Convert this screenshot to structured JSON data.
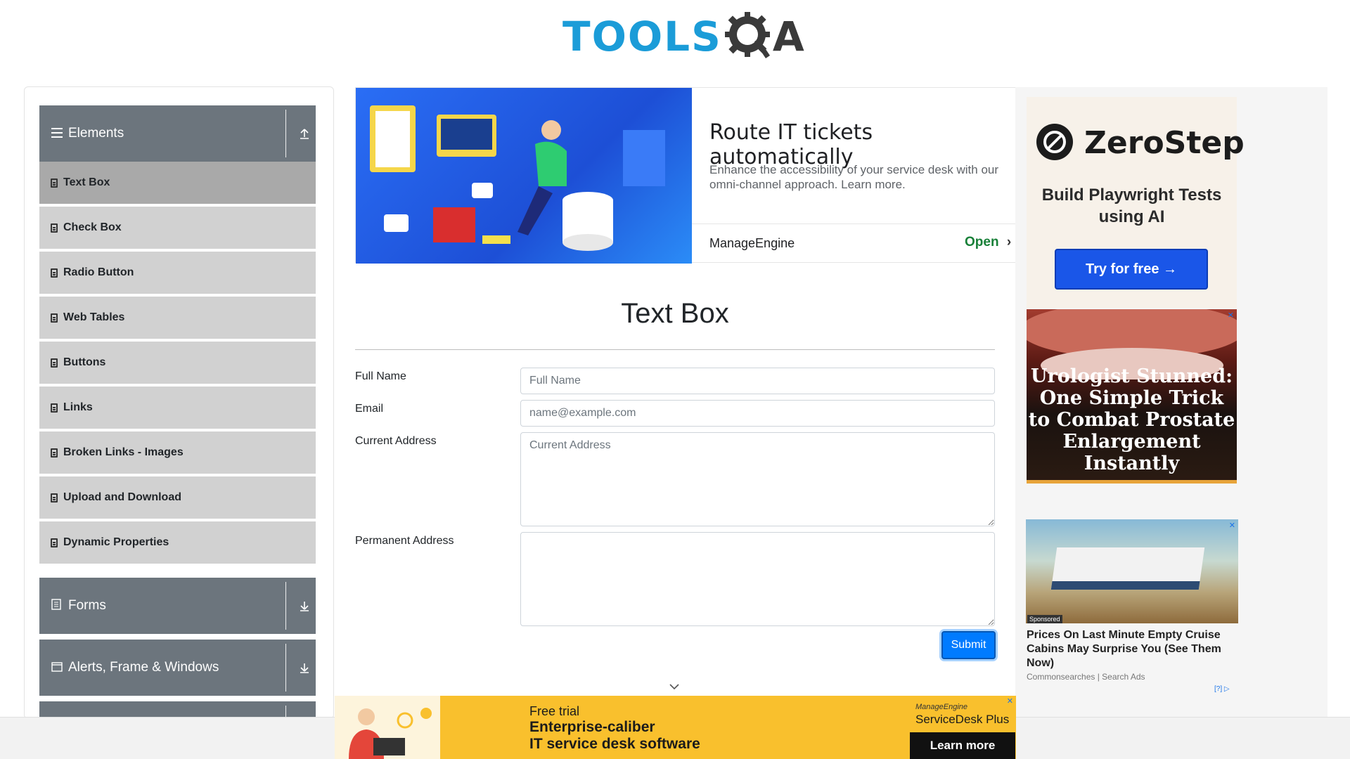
{
  "logo": {
    "tools": "TOOLS",
    "a": "A"
  },
  "sidebar": {
    "groups": [
      {
        "label": "Elements",
        "icon": "menu-icon",
        "arrow": "collapse-up-icon"
      },
      {
        "label": "Forms",
        "icon": "form-icon",
        "arrow": "expand-down-icon"
      },
      {
        "label": "Alerts, Frame & Windows",
        "icon": "window-icon",
        "arrow": "expand-down-icon"
      }
    ],
    "items": [
      {
        "label": "Text Box",
        "active": true
      },
      {
        "label": "Check Box"
      },
      {
        "label": "Radio Button"
      },
      {
        "label": "Web Tables"
      },
      {
        "label": "Buttons"
      },
      {
        "label": "Links"
      },
      {
        "label": "Broken Links - Images"
      },
      {
        "label": "Upload and Download"
      },
      {
        "label": "Dynamic Properties"
      }
    ]
  },
  "top_ad": {
    "title": "Route IT tickets automatically",
    "description": "Enhance the accessibility of your service desk with our omni-channel approach. Learn more.",
    "brand": "ManageEngine",
    "open_label": "Open"
  },
  "form": {
    "title": "Text Box",
    "full_name_label": "Full Name",
    "full_name_placeholder": "Full Name",
    "email_label": "Email",
    "email_placeholder": "name@example.com",
    "current_address_label": "Current Address",
    "current_address_placeholder": "Current Address",
    "permanent_address_label": "Permanent Address",
    "submit_label": "Submit"
  },
  "right_ads": {
    "zerostep": {
      "brand": "ZeroStep",
      "headline": "Build Playwright Tests using AI",
      "cta": "Try for free →"
    },
    "urologist": {
      "headline": "Urologist Stunned: One Simple Trick to Combat Prostate Enlargement Instantly"
    },
    "cruise": {
      "sponsored": "Sponsored",
      "title": "Prices On Last Minute Empty Cruise Cabins May Surprise You (See Them Now)",
      "source": "Commonsearches | Search Ads",
      "adchoice": "[?]"
    }
  },
  "bottom_ad": {
    "line1": "Free trial",
    "line2": "Enterprise-caliber",
    "line3": "IT service desk software",
    "brand": "ManageEngine",
    "product": "ServiceDesk Plus",
    "cta": "Learn more"
  },
  "colors": {
    "sidebar_header": "#6c757d",
    "menu_item": "#d1d1d1",
    "menu_item_active": "#a9a9a9",
    "submit": "#007bff",
    "logo_blue": "#1b9cd8"
  }
}
